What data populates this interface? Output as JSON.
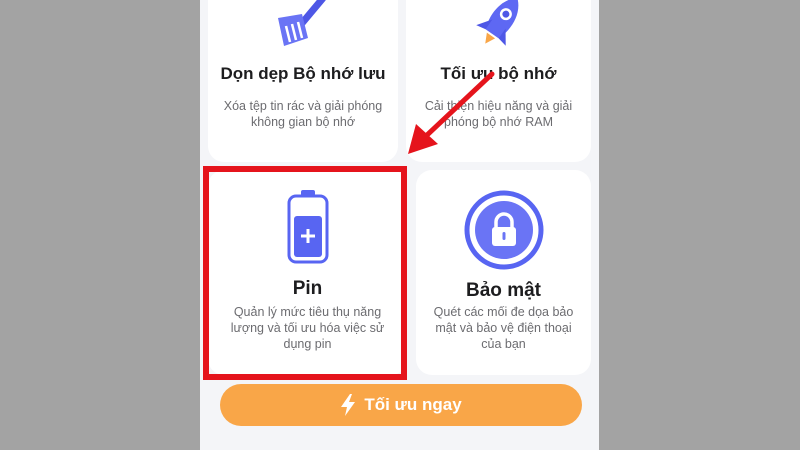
{
  "cards": [
    {
      "key": "cleanup",
      "title": "Dọn dẹp Bộ nhớ lưu",
      "description": "Xóa tệp tin rác và giải phóng không gian bộ nhớ",
      "icon": "broom-icon"
    },
    {
      "key": "optimize",
      "title": "Tối ưu bộ nhớ",
      "description": "Cải thiện hiệu năng và giải phóng bộ nhớ RAM",
      "icon": "rocket-icon"
    },
    {
      "key": "pin",
      "title": "Pin",
      "description": "Quản lý mức tiêu thụ năng lượng và tối ưu hóa việc sử dụng pin",
      "icon": "battery-icon"
    },
    {
      "key": "security",
      "title": "Bảo mật",
      "description": "Quét các mối đe dọa bảo mật và bảo vệ điện thoại của bạn",
      "icon": "lock-icon"
    }
  ],
  "cta": {
    "label": "Tối ưu ngay",
    "icon": "lightning-icon"
  },
  "annotation": {
    "highlight_color": "#e5141c",
    "arrow_color": "#e5141c",
    "target": "pin"
  },
  "colors": {
    "accent": "#5865f2",
    "cta": "#f9a648",
    "background": "#a3a3a3"
  }
}
